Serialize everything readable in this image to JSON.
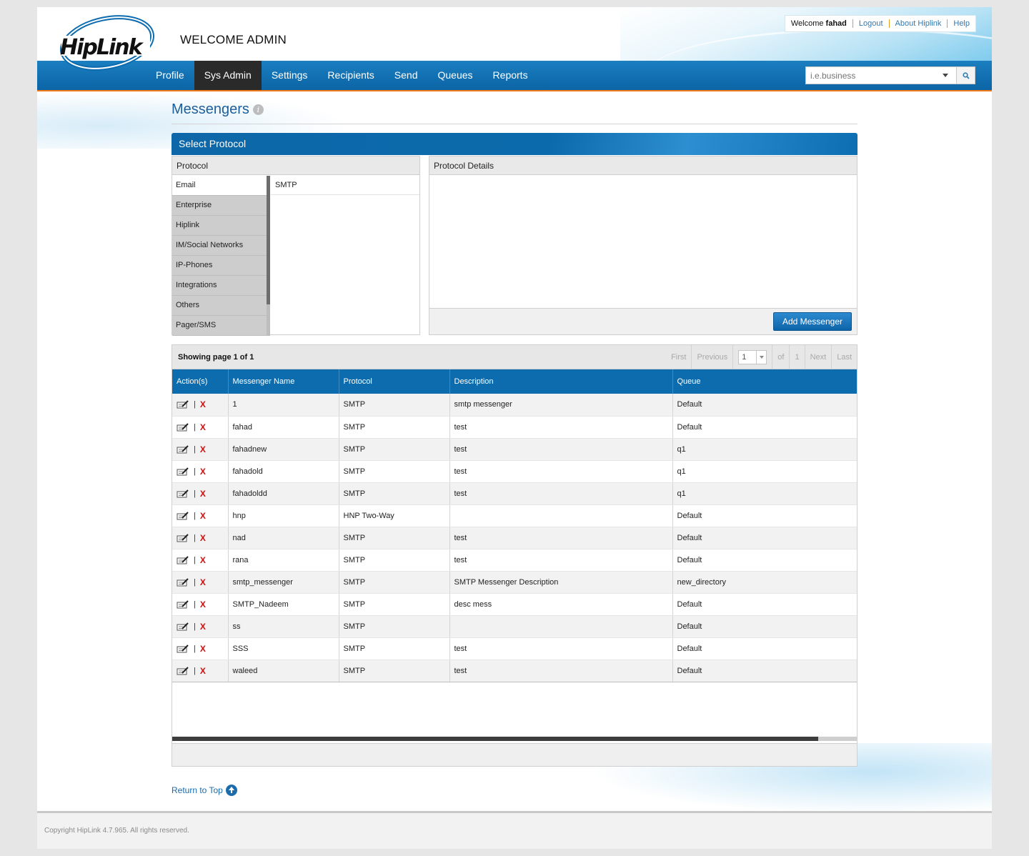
{
  "header": {
    "logo_text": "HipLink",
    "welcome_admin": "WELCOME ADMIN",
    "welcome_prefix": "Welcome",
    "username": "fahad",
    "links": [
      "Logout",
      "About Hiplink",
      "Help"
    ]
  },
  "nav": {
    "items": [
      "Profile",
      "Sys Admin",
      "Settings",
      "Recipients",
      "Send",
      "Queues",
      "Reports"
    ],
    "active": "Sys Admin",
    "search_placeholder": "i.e.business"
  },
  "page": {
    "title": "Messengers",
    "panel_title": "Select Protocol",
    "protocol_header": "Protocol",
    "protocols": [
      "Email",
      "Enterprise",
      "Hiplink",
      "IM/Social Networks",
      "IP-Phones",
      "Integrations",
      "Others",
      "Pager/SMS"
    ],
    "selected_protocol": "Email",
    "sub_protocols": [
      "SMTP"
    ],
    "details_header": "Protocol Details",
    "add_button": "Add Messenger"
  },
  "grid": {
    "showing": "Showing page 1 of 1",
    "pager": {
      "first": "First",
      "previous": "Previous",
      "page": "1",
      "of": "of",
      "total": "1",
      "next": "Next",
      "last": "Last"
    },
    "columns": [
      "Action(s)",
      "Messenger Name",
      "Protocol",
      "Description",
      "Queue"
    ],
    "rows": [
      {
        "name": "1",
        "protocol": "SMTP",
        "description": "smtp messenger",
        "queue": "Default"
      },
      {
        "name": "fahad",
        "protocol": "SMTP",
        "description": "test",
        "queue": "Default"
      },
      {
        "name": "fahadnew",
        "protocol": "SMTP",
        "description": "test",
        "queue": "q1"
      },
      {
        "name": "fahadold",
        "protocol": "SMTP",
        "description": "test",
        "queue": "q1"
      },
      {
        "name": "fahadoldd",
        "protocol": "SMTP",
        "description": "test",
        "queue": "q1"
      },
      {
        "name": "hnp",
        "protocol": "HNP Two-Way",
        "description": "",
        "queue": "Default"
      },
      {
        "name": "nad",
        "protocol": "SMTP",
        "description": "test",
        "queue": "Default"
      },
      {
        "name": "rana",
        "protocol": "SMTP",
        "description": "test",
        "queue": "Default"
      },
      {
        "name": "smtp_messenger",
        "protocol": "SMTP",
        "description": "SMTP Messenger Description",
        "queue": "new_directory"
      },
      {
        "name": "SMTP_Nadeem",
        "protocol": "SMTP",
        "description": "desc mess",
        "queue": "Default"
      },
      {
        "name": "ss",
        "protocol": "SMTP",
        "description": "",
        "queue": "Default"
      },
      {
        "name": "SSS",
        "protocol": "SMTP",
        "description": "test",
        "queue": "Default"
      },
      {
        "name": "waleed",
        "protocol": "SMTP",
        "description": "test",
        "queue": "Default"
      }
    ],
    "delete_glyph": "X",
    "separator_glyph": "|"
  },
  "return_top": "Return to Top",
  "footer": {
    "copyright": "Copyright HipLink 4.7.965. All rights reserved."
  },
  "colors": {
    "brand_blue": "#0c6cad",
    "accent_orange": "#f07a1a",
    "delete_red": "#d01010"
  }
}
